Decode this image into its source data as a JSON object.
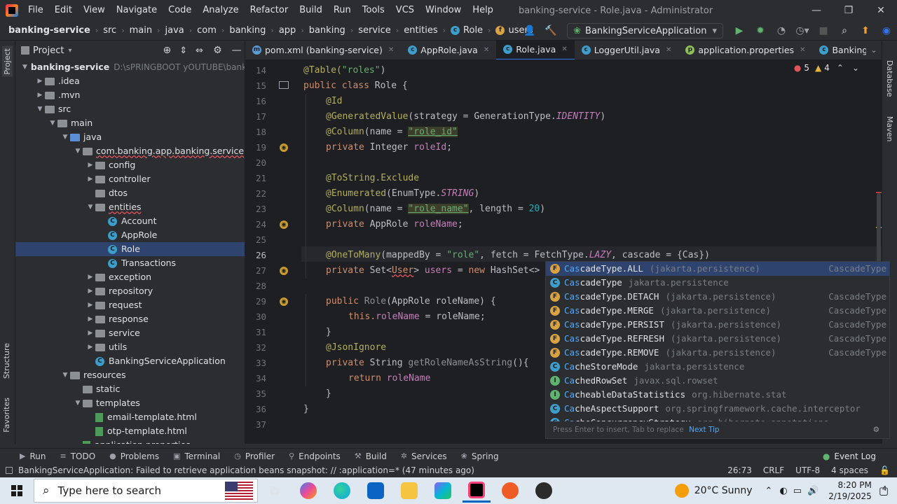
{
  "titlebar": {
    "menu": [
      "File",
      "Edit",
      "View",
      "Navigate",
      "Code",
      "Analyze",
      "Refactor",
      "Build",
      "Run",
      "Tools",
      "VCS",
      "Window",
      "Help"
    ],
    "title": "banking-service - Role.java - Administrator"
  },
  "breadcrumb": [
    "banking-service",
    "src",
    "main",
    "java",
    "com",
    "banking",
    "app",
    "banking",
    "service",
    "entities",
    "Role",
    "users"
  ],
  "run_config": "BankingServiceApplication",
  "left_tools": {
    "project": "Project",
    "structure": "Structure",
    "favorites": "Favorites"
  },
  "right_tools": {
    "database": "Database",
    "maven": "Maven"
  },
  "project_panel": {
    "title": "Project",
    "tree": [
      {
        "label": "banking-service",
        "extra": "D:\\sPRINGBOOT yOUTUBE\\banking",
        "kind": "module",
        "depth": 0,
        "open": true
      },
      {
        "label": ".idea",
        "kind": "folder",
        "depth": 1,
        "open": false
      },
      {
        "label": ".mvn",
        "kind": "folder",
        "depth": 1,
        "open": false
      },
      {
        "label": "src",
        "kind": "folder",
        "depth": 1,
        "open": true
      },
      {
        "label": "main",
        "kind": "folder",
        "depth": 2,
        "open": true
      },
      {
        "label": "java",
        "kind": "folder-blue",
        "depth": 3,
        "open": true
      },
      {
        "label": "com.banking.app.banking.service",
        "kind": "folder",
        "depth": 4,
        "open": true,
        "err": true
      },
      {
        "label": "config",
        "kind": "folder",
        "depth": 5,
        "open": false
      },
      {
        "label": "controller",
        "kind": "folder",
        "depth": 5,
        "open": false
      },
      {
        "label": "dtos",
        "kind": "folder",
        "depth": 5,
        "leaf": true
      },
      {
        "label": "entities",
        "kind": "folder",
        "depth": 5,
        "open": true,
        "err": true
      },
      {
        "label": "Account",
        "kind": "class",
        "depth": 6
      },
      {
        "label": "AppRole",
        "kind": "class",
        "depth": 6
      },
      {
        "label": "Role",
        "kind": "class",
        "depth": 6,
        "selected": true
      },
      {
        "label": "Transactions",
        "kind": "class",
        "depth": 6
      },
      {
        "label": "exception",
        "kind": "folder",
        "depth": 5,
        "open": false
      },
      {
        "label": "repository",
        "kind": "folder",
        "depth": 5,
        "open": false
      },
      {
        "label": "request",
        "kind": "folder",
        "depth": 5,
        "open": false
      },
      {
        "label": "response",
        "kind": "folder",
        "depth": 5,
        "open": false
      },
      {
        "label": "service",
        "kind": "folder",
        "depth": 5,
        "open": false
      },
      {
        "label": "utils",
        "kind": "folder",
        "depth": 5,
        "open": false
      },
      {
        "label": "BankingServiceApplication",
        "kind": "class",
        "depth": 5
      },
      {
        "label": "resources",
        "kind": "folder",
        "depth": 3,
        "open": true
      },
      {
        "label": "static",
        "kind": "folder",
        "depth": 4,
        "leaf": true
      },
      {
        "label": "templates",
        "kind": "folder",
        "depth": 4,
        "open": true
      },
      {
        "label": "email-template.html",
        "kind": "file",
        "depth": 5
      },
      {
        "label": "otp-template.html",
        "kind": "file",
        "depth": 5
      },
      {
        "label": "application.properties",
        "kind": "file",
        "depth": 4
      }
    ]
  },
  "tabs": [
    {
      "label": "pom.xml (banking-service)",
      "icon": "m"
    },
    {
      "label": "AppRole.java",
      "icon": "c"
    },
    {
      "label": "Role.java",
      "icon": "c",
      "active": true
    },
    {
      "label": "LoggerUtil.java",
      "icon": "c"
    },
    {
      "label": "application.properties",
      "icon": "p"
    },
    {
      "label": "BankingServiceApplication.ja",
      "icon": "c"
    }
  ],
  "inspections": {
    "errors": "5",
    "warnings": "4"
  },
  "line_numbers": [
    "14",
    "15",
    "16",
    "17",
    "18",
    "19",
    "20",
    "21",
    "22",
    "23",
    "24",
    "25",
    "26",
    "27",
    "28",
    "29",
    "30",
    "31",
    "32",
    "33",
    "34",
    "35",
    "36",
    "37"
  ],
  "code": {
    "l14": [
      "@Table(",
      {
        "t": "\"roles\"",
        "c": "st"
      },
      ")"
    ],
    "l15a": "public class ",
    "l15b": "Role {",
    "l16": "@Id",
    "l17a": "@GeneratedValue",
    "l17b": "(strategy = GenerationType.",
    "l17c": "IDENTITY",
    "l17d": ")",
    "l18a": "@Column",
    "l18b": "(name = ",
    "l18c": "\"role_id\"",
    "l18d": ")",
    "l19a": "private ",
    "l19b": "Integer ",
    "l19c": "roleId",
    ";": ";",
    "l21": "@ToString.Exclude",
    "l22a": "@Enumerated",
    "l22b": "(EnumType.",
    "l22c": "STRING",
    "l22d": ")",
    "l23a": "@Column",
    "l23b": "(name = ",
    "l23c": "\"role_name\"",
    "l23d": ", length = ",
    "l23e": "20",
    "l23f": ")",
    "l24a": "private ",
    "l24b": "AppRole ",
    "l24c": "roleName",
    "l26a": "@OneToMany",
    "l26b": "(mappedBy = ",
    "l26c": "\"role\"",
    "l26d": ", fetch = FetchType.",
    "l26e": "LAZY",
    "l26f": ", cascade = {Cas})",
    "l27a": "private ",
    "l27b": "Set<",
    "l27c": "User",
    "l27d": "> ",
    "l27e": "users",
    " l27f": " = ",
    "l27g": "new ",
    "l27h": "HashSet<>",
    "l29a": "public ",
    "l29b": "Role",
    "l29c": "(AppRole roleName) {",
    "l30a": "this.",
    "l30b": "roleName",
    " l30c": " = roleName;",
    "l31": "}",
    "l32": "@JsonIgnore",
    "l33a": "private ",
    "l33b": "String ",
    "l33c": "getRoleNameAsString",
    "l33d": "(){",
    "l34a": "return ",
    "l34b": "roleName",
    ".toString": ".toString();",
    "l35": "}",
    "l36": "}"
  },
  "completion": {
    "items": [
      {
        "icon": "f",
        "match": "Cas",
        "rest": "cadeType.ALL",
        "pkg": "(jakarta.persistence)",
        "type": "CascadeType",
        "selected": true
      },
      {
        "icon": "c",
        "match": "Cas",
        "rest": "cadeType",
        "pkg": "jakarta.persistence",
        "type": ""
      },
      {
        "icon": "f",
        "match": "Cas",
        "rest": "cadeType.DETACH",
        "pkg": "(jakarta.persistence)",
        "type": "CascadeType"
      },
      {
        "icon": "f",
        "match": "Cas",
        "rest": "cadeType.MERGE",
        "pkg": "(jakarta.persistence)",
        "type": "CascadeType"
      },
      {
        "icon": "f",
        "match": "Cas",
        "rest": "cadeType.PERSIST",
        "pkg": "(jakarta.persistence)",
        "type": "CascadeType"
      },
      {
        "icon": "f",
        "match": "Cas",
        "rest": "cadeType.REFRESH",
        "pkg": "(jakarta.persistence)",
        "type": "CascadeType"
      },
      {
        "icon": "f",
        "match": "Cas",
        "rest": "cadeType.REMOVE",
        "pkg": "(jakarta.persistence)",
        "type": "CascadeType"
      },
      {
        "icon": "c",
        "match": "Ca",
        "rest": "cheStoreMode",
        "pkg": "jakarta.persistence",
        "type": ""
      },
      {
        "icon": "i",
        "match": "Ca",
        "rest": "chedRowSet",
        "pkg": "javax.sql.rowset",
        "type": ""
      },
      {
        "icon": "i",
        "match": "Ca",
        "rest": "cheableDataStatistics",
        "pkg": "org.hibernate.stat",
        "type": ""
      },
      {
        "icon": "c",
        "match": "Ca",
        "rest": "cheAspectSupport",
        "pkg": "org.springframework.cache.interceptor",
        "type": ""
      },
      {
        "icon": "c",
        "match": "Ca",
        "rest": "cheConcurrencyStrategy",
        "pkg": "org.hibernate.annotations",
        "type": ""
      }
    ],
    "footer": "Press Enter to insert, Tab to replace",
    "footer_link": "Next Tip"
  },
  "toolwindows": [
    {
      "label": "Run",
      "g": "▶"
    },
    {
      "label": "TODO",
      "g": "≡"
    },
    {
      "label": "Problems",
      "g": "●"
    },
    {
      "label": "Terminal",
      "g": "▣"
    },
    {
      "label": "Profiler",
      "g": "◷"
    },
    {
      "label": "Endpoints",
      "g": "⚲"
    },
    {
      "label": "Build",
      "g": "⚒"
    },
    {
      "label": "Services",
      "g": "✲"
    },
    {
      "label": "Spring",
      "g": "❀"
    }
  ],
  "event_log": "Event Log",
  "status": {
    "message": "BankingServiceApplication: Failed to retrieve application beans snapshot: // :application=* (47 minutes ago)",
    "position": "26:73",
    "line_sep": "CRLF",
    "encoding": "UTF-8",
    "indent": "4 spaces"
  },
  "taskbar": {
    "search_placeholder": "Type here to search",
    "weather": "20°C  Sunny",
    "time": "8:20 PM",
    "date": "2/19/2025",
    "notifications": "4"
  }
}
